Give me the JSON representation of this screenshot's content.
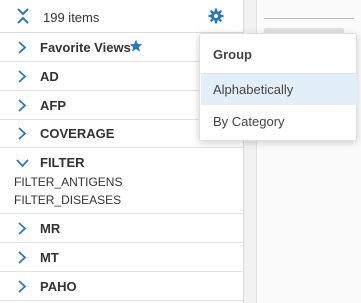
{
  "header": {
    "item_count_label": "199 items"
  },
  "groups": [
    {
      "label": "Favorite Views",
      "favorite": true
    },
    {
      "label": "AD"
    },
    {
      "label": "AFP"
    },
    {
      "label": "COVERAGE"
    },
    {
      "label": "FILTER",
      "expanded": true,
      "children": [
        "FILTER_ANTIGENS",
        "FILTER_DISEASES"
      ]
    },
    {
      "label": "MR"
    },
    {
      "label": "MT"
    },
    {
      "label": "PAHO"
    }
  ],
  "group_menu": {
    "heading": "Group",
    "options": [
      "Alphabetically",
      "By Category"
    ],
    "selected": "Alphabetically"
  },
  "colors": {
    "accent": "#2a7ab8",
    "selected_bg": "#e3eff8",
    "text": "#333333"
  }
}
